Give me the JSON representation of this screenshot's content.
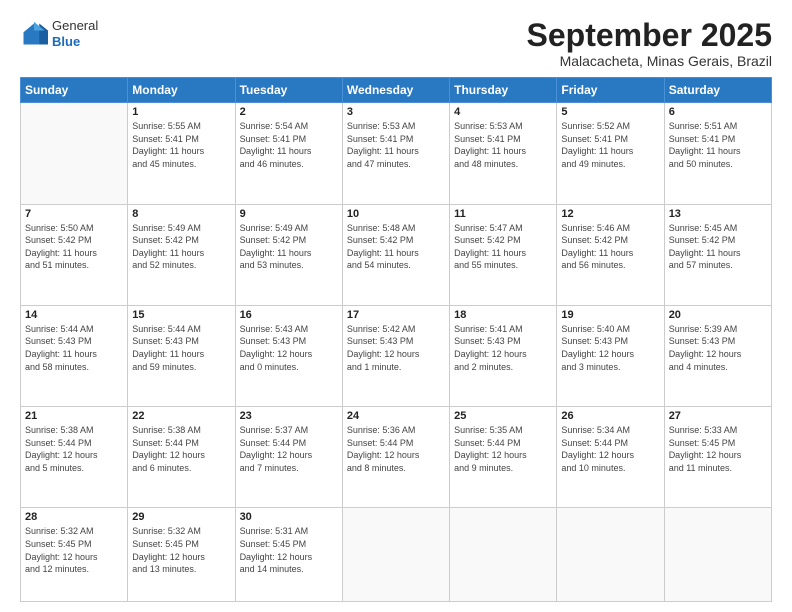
{
  "header": {
    "logo": {
      "general": "General",
      "blue": "Blue"
    },
    "month": "September 2025",
    "location": "Malacacheta, Minas Gerais, Brazil"
  },
  "weekdays": [
    "Sunday",
    "Monday",
    "Tuesday",
    "Wednesday",
    "Thursday",
    "Friday",
    "Saturday"
  ],
  "weeks": [
    [
      {
        "day": "",
        "info": ""
      },
      {
        "day": "1",
        "info": "Sunrise: 5:55 AM\nSunset: 5:41 PM\nDaylight: 11 hours\nand 45 minutes."
      },
      {
        "day": "2",
        "info": "Sunrise: 5:54 AM\nSunset: 5:41 PM\nDaylight: 11 hours\nand 46 minutes."
      },
      {
        "day": "3",
        "info": "Sunrise: 5:53 AM\nSunset: 5:41 PM\nDaylight: 11 hours\nand 47 minutes."
      },
      {
        "day": "4",
        "info": "Sunrise: 5:53 AM\nSunset: 5:41 PM\nDaylight: 11 hours\nand 48 minutes."
      },
      {
        "day": "5",
        "info": "Sunrise: 5:52 AM\nSunset: 5:41 PM\nDaylight: 11 hours\nand 49 minutes."
      },
      {
        "day": "6",
        "info": "Sunrise: 5:51 AM\nSunset: 5:41 PM\nDaylight: 11 hours\nand 50 minutes."
      }
    ],
    [
      {
        "day": "7",
        "info": "Sunrise: 5:50 AM\nSunset: 5:42 PM\nDaylight: 11 hours\nand 51 minutes."
      },
      {
        "day": "8",
        "info": "Sunrise: 5:49 AM\nSunset: 5:42 PM\nDaylight: 11 hours\nand 52 minutes."
      },
      {
        "day": "9",
        "info": "Sunrise: 5:49 AM\nSunset: 5:42 PM\nDaylight: 11 hours\nand 53 minutes."
      },
      {
        "day": "10",
        "info": "Sunrise: 5:48 AM\nSunset: 5:42 PM\nDaylight: 11 hours\nand 54 minutes."
      },
      {
        "day": "11",
        "info": "Sunrise: 5:47 AM\nSunset: 5:42 PM\nDaylight: 11 hours\nand 55 minutes."
      },
      {
        "day": "12",
        "info": "Sunrise: 5:46 AM\nSunset: 5:42 PM\nDaylight: 11 hours\nand 56 minutes."
      },
      {
        "day": "13",
        "info": "Sunrise: 5:45 AM\nSunset: 5:42 PM\nDaylight: 11 hours\nand 57 minutes."
      }
    ],
    [
      {
        "day": "14",
        "info": "Sunrise: 5:44 AM\nSunset: 5:43 PM\nDaylight: 11 hours\nand 58 minutes."
      },
      {
        "day": "15",
        "info": "Sunrise: 5:44 AM\nSunset: 5:43 PM\nDaylight: 11 hours\nand 59 minutes."
      },
      {
        "day": "16",
        "info": "Sunrise: 5:43 AM\nSunset: 5:43 PM\nDaylight: 12 hours\nand 0 minutes."
      },
      {
        "day": "17",
        "info": "Sunrise: 5:42 AM\nSunset: 5:43 PM\nDaylight: 12 hours\nand 1 minute."
      },
      {
        "day": "18",
        "info": "Sunrise: 5:41 AM\nSunset: 5:43 PM\nDaylight: 12 hours\nand 2 minutes."
      },
      {
        "day": "19",
        "info": "Sunrise: 5:40 AM\nSunset: 5:43 PM\nDaylight: 12 hours\nand 3 minutes."
      },
      {
        "day": "20",
        "info": "Sunrise: 5:39 AM\nSunset: 5:43 PM\nDaylight: 12 hours\nand 4 minutes."
      }
    ],
    [
      {
        "day": "21",
        "info": "Sunrise: 5:38 AM\nSunset: 5:44 PM\nDaylight: 12 hours\nand 5 minutes."
      },
      {
        "day": "22",
        "info": "Sunrise: 5:38 AM\nSunset: 5:44 PM\nDaylight: 12 hours\nand 6 minutes."
      },
      {
        "day": "23",
        "info": "Sunrise: 5:37 AM\nSunset: 5:44 PM\nDaylight: 12 hours\nand 7 minutes."
      },
      {
        "day": "24",
        "info": "Sunrise: 5:36 AM\nSunset: 5:44 PM\nDaylight: 12 hours\nand 8 minutes."
      },
      {
        "day": "25",
        "info": "Sunrise: 5:35 AM\nSunset: 5:44 PM\nDaylight: 12 hours\nand 9 minutes."
      },
      {
        "day": "26",
        "info": "Sunrise: 5:34 AM\nSunset: 5:44 PM\nDaylight: 12 hours\nand 10 minutes."
      },
      {
        "day": "27",
        "info": "Sunrise: 5:33 AM\nSunset: 5:45 PM\nDaylight: 12 hours\nand 11 minutes."
      }
    ],
    [
      {
        "day": "28",
        "info": "Sunrise: 5:32 AM\nSunset: 5:45 PM\nDaylight: 12 hours\nand 12 minutes."
      },
      {
        "day": "29",
        "info": "Sunrise: 5:32 AM\nSunset: 5:45 PM\nDaylight: 12 hours\nand 13 minutes."
      },
      {
        "day": "30",
        "info": "Sunrise: 5:31 AM\nSunset: 5:45 PM\nDaylight: 12 hours\nand 14 minutes."
      },
      {
        "day": "",
        "info": ""
      },
      {
        "day": "",
        "info": ""
      },
      {
        "day": "",
        "info": ""
      },
      {
        "day": "",
        "info": ""
      }
    ]
  ]
}
